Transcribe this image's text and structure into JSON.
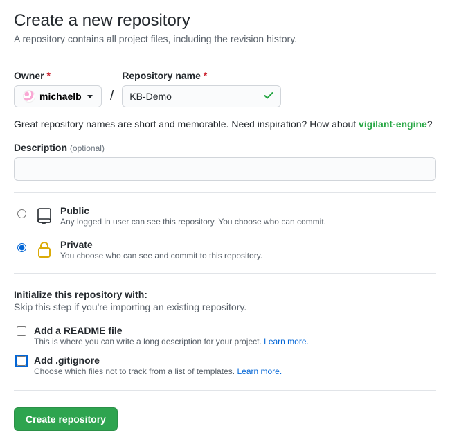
{
  "header": {
    "title": "Create a new repository",
    "subtitle": "A repository contains all project files, including the revision history."
  },
  "owner": {
    "label": "Owner",
    "username": "michaelb"
  },
  "repo": {
    "label": "Repository name",
    "value": "KB-Demo"
  },
  "name_hint": {
    "prefix": "Great repository names are short and memorable. Need inspiration? How about ",
    "suggestion": "vigilant-engine",
    "suffix": "?"
  },
  "description": {
    "label": "Description",
    "optional": "(optional)",
    "value": ""
  },
  "visibility": {
    "public": {
      "title": "Public",
      "desc": "Any logged in user can see this repository. You choose who can commit."
    },
    "private": {
      "title": "Private",
      "desc": "You choose who can see and commit to this repository."
    },
    "selected": "private"
  },
  "initialize": {
    "heading": "Initialize this repository with:",
    "subheading": "Skip this step if you're importing an existing repository.",
    "readme": {
      "title": "Add a README file",
      "desc": "This is where you can write a long description for your project. ",
      "learn": "Learn more."
    },
    "gitignore": {
      "title": "Add .gitignore",
      "desc": "Choose which files not to track from a list of templates. ",
      "learn": "Learn more."
    }
  },
  "submit_label": "Create repository"
}
